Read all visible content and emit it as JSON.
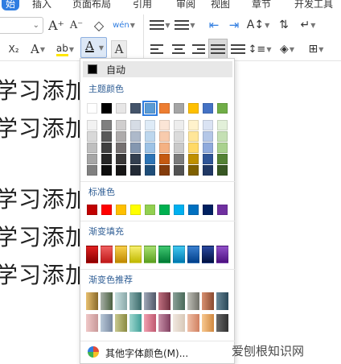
{
  "menubar": {
    "items": [
      {
        "label": "始",
        "active": true
      },
      {
        "label": "插入",
        "active": false
      },
      {
        "label": "页面布局",
        "active": false
      },
      {
        "label": "引用",
        "active": false
      },
      {
        "label": "审阅",
        "active": false
      },
      {
        "label": "视图",
        "active": false
      },
      {
        "label": "章节",
        "active": false
      },
      {
        "label": "开发工具",
        "active": false
      }
    ]
  },
  "ribbon": {
    "font_size_value": "",
    "grow_font": "A⁺",
    "shrink_font": "A⁻",
    "clear_format": "◇",
    "phonetic": "wén",
    "subscript": "X₂",
    "text_effect": "A",
    "highlight": "ab",
    "font_color": "A",
    "char_shading": "A",
    "accent_color": "#2f7de1",
    "highlight_color": "#ffe600"
  },
  "document": {
    "lines": [
      "学习添加",
      "学习添加",
      "学习添加",
      "学习添加",
      "学习添加"
    ]
  },
  "color_panel": {
    "auto_label": "自动",
    "theme_label": "主题颜色",
    "standard_label": "标准色",
    "gradient_label": "渐变填充",
    "recommended_label": "渐变色推荐",
    "more_label": "其他字体颜色(M)...",
    "theme_colors": [
      "#ffffff",
      "#000000",
      "#e7e6e6",
      "#44546a",
      "#5b9bd5",
      "#ed7d31",
      "#a5a5a5",
      "#ffc000",
      "#4472c4",
      "#70ad47"
    ],
    "theme_shades": [
      [
        "#f2f2f2",
        "#d9d9d9",
        "#bfbfbf",
        "#a6a6a6",
        "#808080"
      ],
      [
        "#7f7f7f",
        "#595959",
        "#404040",
        "#262626",
        "#0d0d0d"
      ],
      [
        "#d0cece",
        "#aeabab",
        "#757070",
        "#3a3838",
        "#171616"
      ],
      [
        "#d6dce5",
        "#adb9ca",
        "#8497b0",
        "#333f50",
        "#222a35"
      ],
      [
        "#deebf7",
        "#bdd7ee",
        "#9dc3e6",
        "#2e75b6",
        "#1f4e79"
      ],
      [
        "#fbe5d6",
        "#f8cbad",
        "#f4b183",
        "#c55a11",
        "#843c0c"
      ],
      [
        "#ededed",
        "#dbdbdb",
        "#c9c9c9",
        "#7b7b7b",
        "#525252"
      ],
      [
        "#fff2cc",
        "#ffe699",
        "#ffd966",
        "#bf9000",
        "#7f6000"
      ],
      [
        "#dae3f3",
        "#b4c7e7",
        "#8faadc",
        "#2f5597",
        "#203864"
      ],
      [
        "#e2f0d9",
        "#c5e0b4",
        "#a9d18e",
        "#548235",
        "#385723"
      ]
    ],
    "selected_theme_index": 4,
    "standard_colors": [
      "#c00000",
      "#ff0000",
      "#ffc000",
      "#ffff00",
      "#92d050",
      "#00b050",
      "#00b0f0",
      "#0070c0",
      "#002060",
      "#7030a0"
    ],
    "gradient_fills": [
      [
        "#e02020",
        "#8b0000"
      ],
      [
        "#f06060",
        "#c01818"
      ],
      [
        "#f8d04a",
        "#c08800"
      ],
      [
        "#f8f070",
        "#c0b800"
      ],
      [
        "#a8e070",
        "#5aa020"
      ],
      [
        "#40c870",
        "#007a34"
      ],
      [
        "#40c8f0",
        "#0078b0"
      ],
      [
        "#3a80d0",
        "#003f8a"
      ],
      [
        "#2a48a0",
        "#001040"
      ],
      [
        "#9050c8",
        "#4c1080"
      ]
    ],
    "recommended_row1": [
      [
        "#e8c070",
        "#8a6a2a"
      ],
      [
        "#a8b0a8",
        "#4a6040"
      ],
      [
        "#c8e0e0",
        "#8aa8a8"
      ],
      [
        "#8ab0b0",
        "#3a6a6a"
      ],
      [
        "#a0a8b8",
        "#505868"
      ],
      [
        "#c07080",
        "#703040"
      ],
      [
        "#8aa098",
        "#4a6a5a"
      ],
      [
        "#c0c0b8",
        "#707068"
      ],
      [
        "#d89070",
        "#8a4a30"
      ],
      [
        "#6a8898",
        "#2a4858"
      ]
    ],
    "recommended_row2": [
      [
        "#f0c8c8",
        "#c89898"
      ],
      [
        "#b8c8d8",
        "#7888a0"
      ],
      [
        "#c8c890",
        "#8a8a40"
      ],
      [
        "#a0d8d0",
        "#40a098"
      ],
      [
        "#f0a0b0",
        "#c05870"
      ],
      [
        "#c890a8",
        "#804060"
      ],
      [
        "#f0e8e0",
        "#d8c8b8"
      ],
      [
        "#f0c0a8",
        "#d08060"
      ],
      [
        "#f8c890",
        "#d08840"
      ],
      [
        "#686868",
        "#303030"
      ]
    ]
  },
  "watermark": "爱刨根知识网"
}
